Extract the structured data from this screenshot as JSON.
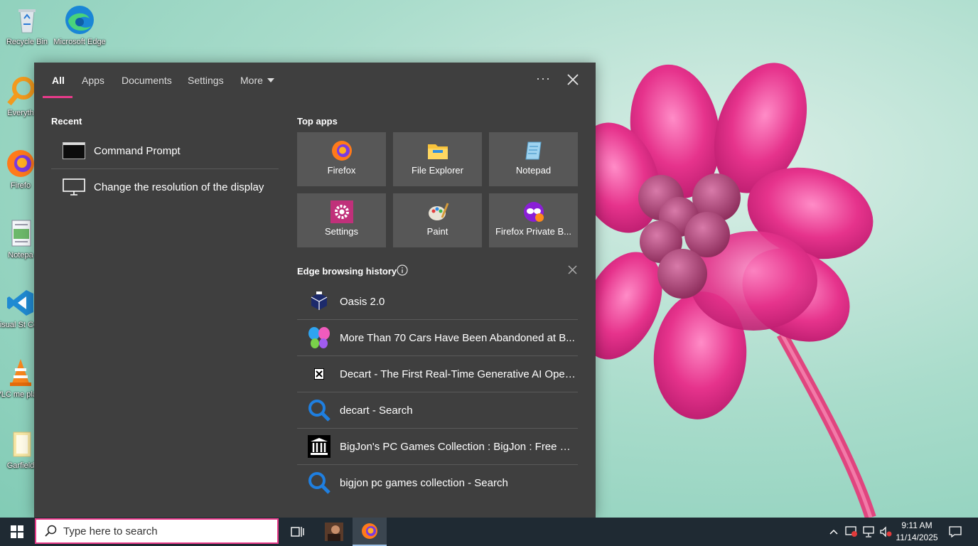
{
  "desktop": {
    "icons": [
      {
        "label": "Recycle Bin",
        "icon": "recycle-bin-icon"
      },
      {
        "label": "Microsoft Edge",
        "icon": "edge-icon"
      },
      {
        "label": "Everyth",
        "icon": "everything-icon"
      },
      {
        "label": "Firefo",
        "icon": "firefox-icon"
      },
      {
        "label": "Notepa",
        "icon": "notepad-icon"
      },
      {
        "label": "Visual St Code",
        "icon": "vscode-icon"
      },
      {
        "label": "VLC me playe",
        "icon": "vlc-icon"
      },
      {
        "label": "Garfield",
        "icon": "folder-icon"
      }
    ]
  },
  "panel": {
    "tabs": [
      {
        "label": "All",
        "active": true
      },
      {
        "label": "Apps"
      },
      {
        "label": "Documents"
      },
      {
        "label": "Settings"
      },
      {
        "label": "More"
      }
    ],
    "more_options_label": "···",
    "recent": {
      "title": "Recent",
      "items": [
        {
          "label": "Command Prompt",
          "icon": "command-prompt-icon"
        },
        {
          "label": "Change the resolution of the display",
          "icon": "monitor-icon"
        }
      ]
    },
    "top_apps": {
      "title": "Top apps",
      "items": [
        {
          "label": "Firefox",
          "icon": "firefox-icon"
        },
        {
          "label": "File Explorer",
          "icon": "file-explorer-icon"
        },
        {
          "label": "Notepad",
          "icon": "notepad-icon"
        },
        {
          "label": "Settings",
          "icon": "settings-gear-icon"
        },
        {
          "label": "Paint",
          "icon": "paint-palette-icon"
        },
        {
          "label": "Firefox Private B...",
          "icon": "firefox-private-icon"
        }
      ]
    },
    "history": {
      "title": "Edge browsing history",
      "items": [
        {
          "label": "Oasis 2.0",
          "icon": "oasis-cube-icon"
        },
        {
          "label": "More Than 70 Cars Have Been Abandoned at B...",
          "icon": "butterfly-icon"
        },
        {
          "label": "Decart - The First Real-Time Generative AI Open...",
          "icon": "decart-icon"
        },
        {
          "label": "decart - Search",
          "icon": "search-icon"
        },
        {
          "label": "BigJon's PC Games Collection : BigJon : Free Do...",
          "icon": "archive-building-icon"
        },
        {
          "label": "bigjon pc games collection - Search",
          "icon": "search-icon"
        }
      ]
    }
  },
  "taskbar": {
    "search_placeholder": "Type here to search",
    "time": "9:11 AM",
    "date": "11/14/2025"
  },
  "colors": {
    "accent": "#e83b8a",
    "panel_bg": "#3f3f3f",
    "tile_bg": "#575757",
    "taskbar_bg": "#1f2a33"
  }
}
